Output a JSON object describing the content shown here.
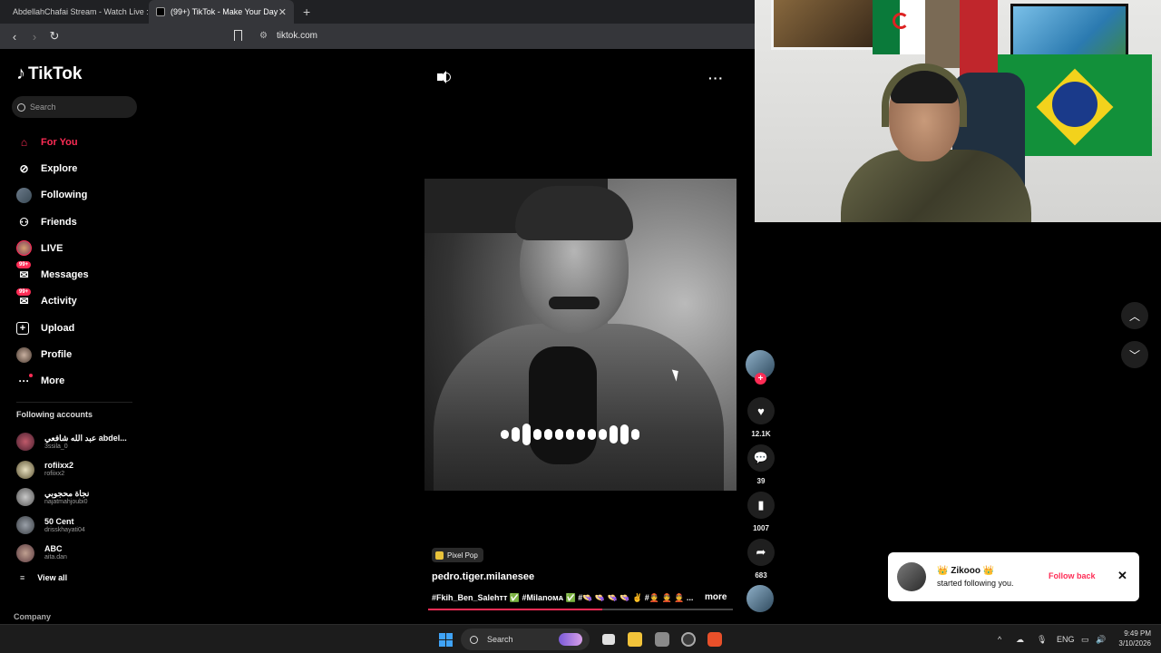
{
  "browser": {
    "tabs": [
      {
        "title": "AbdellahChafai Stream - Watch Live :"
      },
      {
        "title": "(99+) TikTok - Make Your Day"
      }
    ],
    "url": "tiktok.com"
  },
  "sidebar": {
    "logo": "TikTok",
    "search_placeholder": "Search",
    "menu": [
      {
        "label": "For You",
        "icon": "home-icon",
        "active": true
      },
      {
        "label": "Explore",
        "icon": "compass-icon"
      },
      {
        "label": "Following",
        "icon": "avatar-icon"
      },
      {
        "label": "Friends",
        "icon": "friends-icon"
      },
      {
        "label": "LIVE",
        "icon": "live-avatar-icon"
      },
      {
        "label": "Messages",
        "icon": "messages-icon",
        "badge": "99+"
      },
      {
        "label": "Activity",
        "icon": "activity-icon",
        "badge": "99+"
      },
      {
        "label": "Upload",
        "icon": "upload-icon"
      },
      {
        "label": "Profile",
        "icon": "profile-avatar-icon"
      },
      {
        "label": "More",
        "icon": "more-icon"
      }
    ],
    "following_title": "Following accounts",
    "following": [
      {
        "name": "عبد الله شافعي abdel...",
        "handle": "3ssila_0"
      },
      {
        "name": "rofiixx2",
        "handle": "rofiixx2"
      },
      {
        "name": "نجاة محجوبي",
        "handle": "najatmahjoubi0"
      },
      {
        "name": "50 Cent",
        "handle": "drisskhayati04"
      },
      {
        "name": "ABC",
        "handle": "aita.dan"
      }
    ],
    "view_all": "View all",
    "company": "Company"
  },
  "player": {
    "pixel_pop": "Pixel Pop",
    "author": "pedro.tiger.milanesee",
    "description": "#Fkih_Ben_Salehᴛᴛ ✅ #Milanoᴍᴀ ✅ #👒 👒 👒 👒 ✌ #👲 👲 👲 ...",
    "more": "more",
    "progress": 0.57,
    "likes": "12.1K",
    "comments": "39",
    "saves": "1007",
    "shares": "683"
  },
  "notification": {
    "name": "👑 Zikooo 👑",
    "message": "started following you.",
    "action": "Follow back"
  },
  "taskbar": {
    "search": "Search",
    "lang": "ENG",
    "time": "9:49 PM",
    "date": "3/10/2026"
  }
}
